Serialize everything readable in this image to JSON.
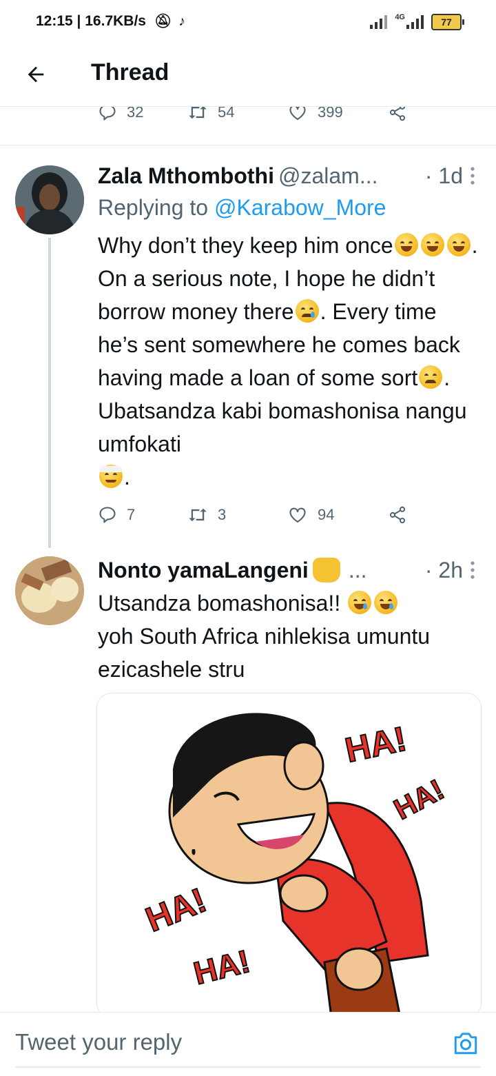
{
  "status_bar": {
    "time_speed": "12:15 | 16.7KB/s",
    "network": "4G",
    "battery": "77"
  },
  "header": {
    "title": "Thread"
  },
  "parent_tweet": {
    "replies": "32",
    "retweets": "54",
    "likes": "399"
  },
  "tweets": [
    {
      "name": "Zala Mthombothi",
      "handle": "@zalam...",
      "time": "· 1d",
      "replying_prefix": "Replying to ",
      "replying_to": "@Karabow_More",
      "text_parts": [
        "Why don’t they keep him once",
        ". On a serious note, I hope he didn’t borrow money there",
        ". Every time he’s sent somewhere he comes back having made a loan of some sort",
        ". Ubatsandza kabi bomashonisa nangu umfokati",
        "."
      ],
      "replies": "7",
      "retweets": "3",
      "likes": "94"
    },
    {
      "name": "Nonto yamaLangeni",
      "handle": "...",
      "time": "· 2h",
      "text_parts": [
        "Utsandza bomashonisa!!",
        "yoh South Africa nihlekisa umuntu ezicashele stru"
      ],
      "media_text": [
        "HA!",
        "HA!",
        "HA!",
        "HA!"
      ]
    }
  ],
  "reply_box": {
    "placeholder": "Tweet your reply"
  },
  "colors": {
    "link": "#1d9bf0",
    "secondary_text": "#536471",
    "divider": "#e6e9eb"
  }
}
